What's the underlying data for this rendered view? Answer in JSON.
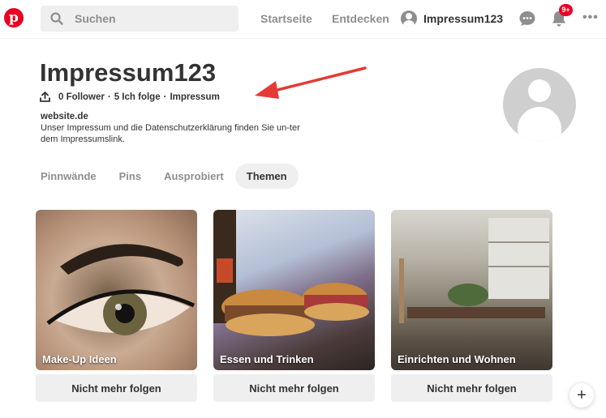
{
  "header": {
    "logo_letter": "p",
    "search_placeholder": "Suchen",
    "nav_home": "Startseite",
    "nav_discover": "Entdecken",
    "username": "Impressum123",
    "notification_badge": "9+"
  },
  "profile": {
    "name": "Impressum123",
    "stats": {
      "followers": "0 Follower",
      "following": "5 Ich folge",
      "link": "Impressum"
    },
    "website": "website.de",
    "bio": "Unser Impressum und die Datenschutzerklärung finden Sie un-ter dem Impressumslink."
  },
  "tabs": [
    "Pinnwände",
    "Pins",
    "Ausprobiert",
    "Themen"
  ],
  "active_tab": "Themen",
  "topics": [
    {
      "title": "Make-Up Ideen",
      "button": "Nicht mehr folgen"
    },
    {
      "title": "Essen und Trinken",
      "button": "Nicht mehr folgen"
    },
    {
      "title": "Einrichten und Wohnen",
      "button": "Nicht mehr folgen"
    }
  ],
  "colors": {
    "brand": "#e60023",
    "annotation_arrow": "#e53935"
  },
  "icons": [
    "pinterest-logo-icon",
    "search-icon",
    "chat-icon",
    "bell-icon",
    "more-icon",
    "upload-icon",
    "plus-icon"
  ]
}
